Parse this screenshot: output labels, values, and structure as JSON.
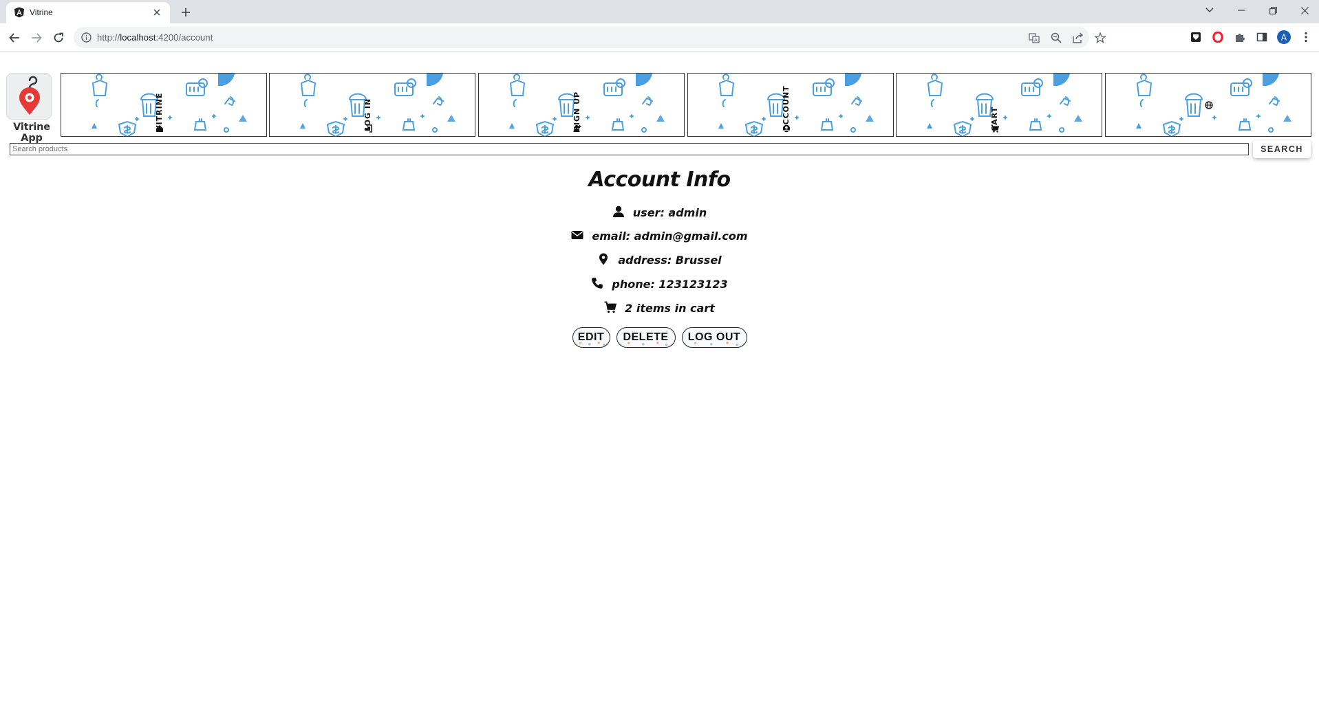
{
  "browser": {
    "tab_title": "Vitrine",
    "url_scheme": "http://",
    "url_host": "localhost",
    "url_rest": ":4200/account",
    "profile_initial": "A"
  },
  "app": {
    "logo_label": "Vitrine App",
    "nav": [
      {
        "label": "VITRINE",
        "icon": "home-icon"
      },
      {
        "label": "LOG IN",
        "icon": "login-icon"
      },
      {
        "label": "SIGN UP",
        "icon": "user-plus-icon"
      },
      {
        "label": "ACCOUNT",
        "icon": "user-circle-icon"
      },
      {
        "label": "CART",
        "icon": "cart-icon"
      },
      {
        "label": "",
        "icon": "globe-icon"
      }
    ],
    "search": {
      "placeholder": "Search products",
      "button_label": "SEARCH"
    }
  },
  "account": {
    "title": "Account Info",
    "user": "user: admin",
    "email": "email: admin@gmail.com",
    "address": "address: Brussel",
    "phone": "phone: 123123123",
    "cart": "2 items in cart",
    "buttons": {
      "edit": "EDIT",
      "delete": "DELETE",
      "logout": "LOG OUT"
    }
  },
  "colors": {
    "pattern_blue": "#4a9fe0",
    "tabstrip": "#dee1e6",
    "logo_red": "#e53935"
  }
}
